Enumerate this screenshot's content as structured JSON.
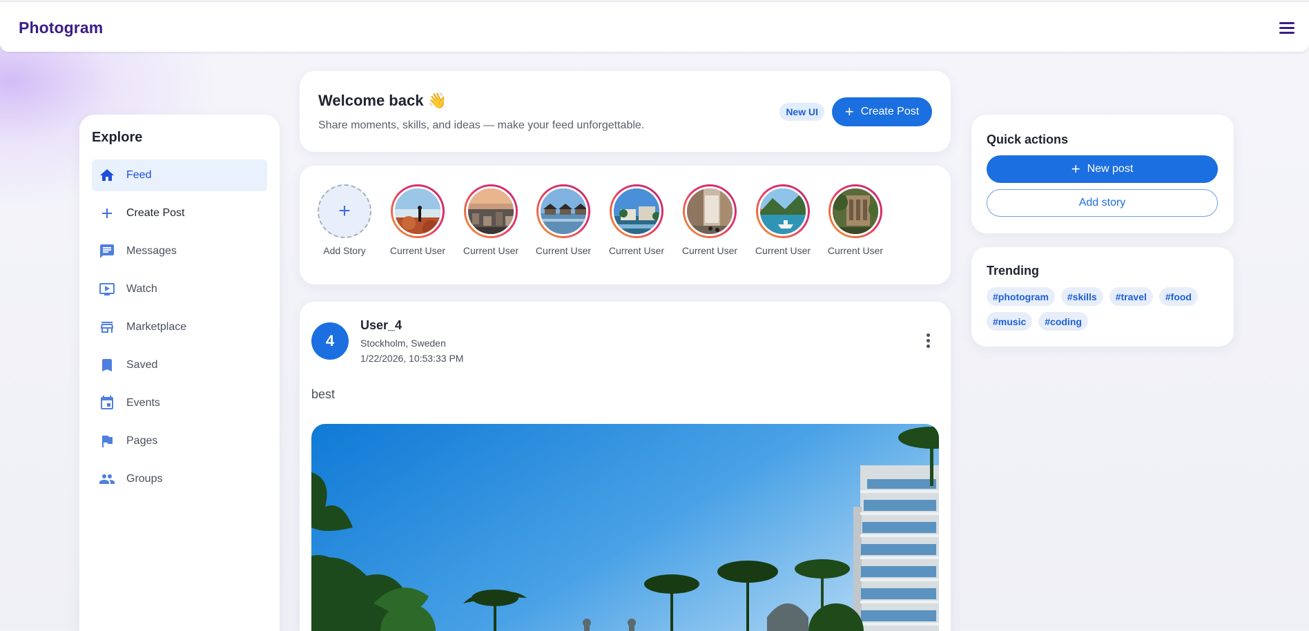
{
  "app": {
    "brand": "Photogram"
  },
  "sidebar": {
    "title": "Explore",
    "items": [
      {
        "label": "Feed",
        "icon": "home-icon"
      },
      {
        "label": "Create Post",
        "icon": "plus-icon"
      },
      {
        "label": "Messages",
        "icon": "chat-icon"
      },
      {
        "label": "Watch",
        "icon": "tv-icon"
      },
      {
        "label": "Marketplace",
        "icon": "store-icon"
      },
      {
        "label": "Saved",
        "icon": "bookmark-icon"
      },
      {
        "label": "Events",
        "icon": "calendar-icon"
      },
      {
        "label": "Pages",
        "icon": "flag-icon"
      },
      {
        "label": "Groups",
        "icon": "people-icon"
      }
    ]
  },
  "welcome": {
    "title": "Welcome back 👋",
    "subtitle": "Share moments, skills, and ideas — make your feed unforgettable.",
    "badge": "New UI",
    "create_label": "Create Post"
  },
  "stories": {
    "add_label": "Add Story",
    "items": [
      {
        "label": "Current User"
      },
      {
        "label": "Current User"
      },
      {
        "label": "Current User"
      },
      {
        "label": "Current User"
      },
      {
        "label": "Current User"
      },
      {
        "label": "Current User"
      },
      {
        "label": "Current User"
      }
    ]
  },
  "post": {
    "avatar_text": "4",
    "username": "User_4",
    "location": "Stockholm, Sweden",
    "timestamp": "1/22/2026, 10:53:33 PM",
    "caption": "best"
  },
  "quick_actions": {
    "title": "Quick actions",
    "new_post_label": "New post",
    "add_story_label": "Add story"
  },
  "trending": {
    "title": "Trending",
    "tags": [
      "#photogram",
      "#skills",
      "#travel",
      "#food",
      "#music",
      "#coding"
    ]
  },
  "colors": {
    "brand": "#3b1c86",
    "primary": "#1b6fe0",
    "active_bg": "#e9f1fd"
  }
}
